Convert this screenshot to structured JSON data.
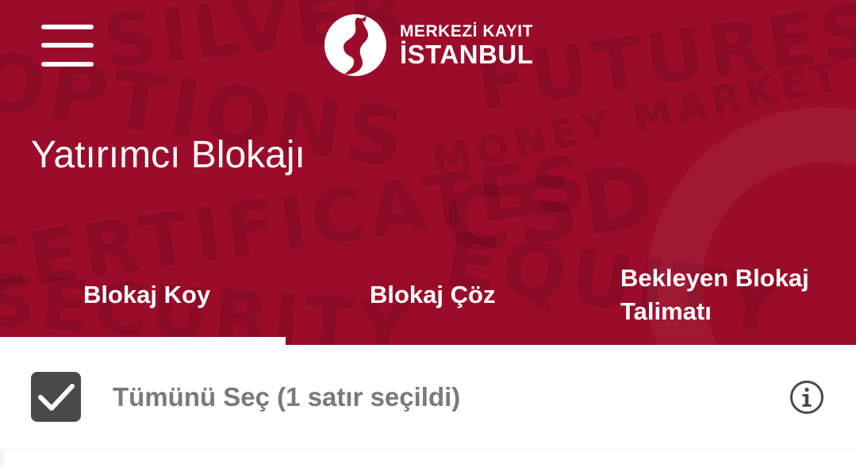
{
  "brand": {
    "line1": "MERKEZİ KAYIT",
    "line2": "İSTANBUL",
    "primary_color": "#9b0c2a"
  },
  "watermark_words": [
    "SILVER",
    "FUTURES",
    "OPTIONS",
    "MONEY MARKET",
    "CSD",
    "CERTIFICATES",
    "EQUITY",
    "SECURITY"
  ],
  "header": {
    "menu_icon": "hamburger-menu-icon",
    "page_title": "Yatırımcı Blokajı"
  },
  "tabs": [
    {
      "label": "Blokaj Koy",
      "active": true
    },
    {
      "label": "Blokaj Çöz",
      "active": false
    },
    {
      "label": "Bekleyen Blokaj Talimatı",
      "active": false
    }
  ],
  "selection": {
    "checked": true,
    "label": "Tümünü Seç (1 satır seçildi)",
    "info_icon": "info-icon"
  }
}
